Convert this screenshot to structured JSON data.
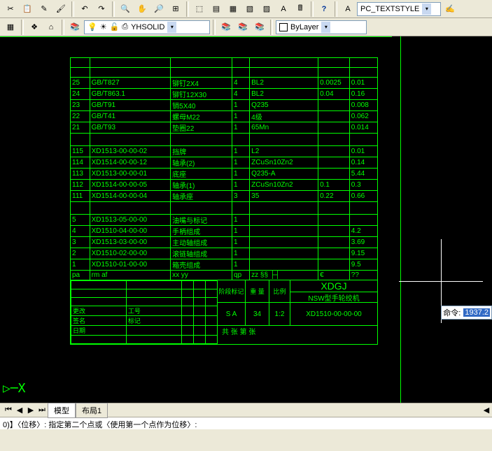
{
  "toolbar": {
    "textstyle_label": "PC_TEXTSTYLE",
    "layer_label": "YHSOLID",
    "bylayer_label": "ByLayer"
  },
  "bom_upper": [
    {
      "n": "25",
      "std": "GB/T827",
      "desc": "铆钉2X4",
      "q": "4",
      "mat": "BL2",
      "w1": "0.0025",
      "w2": "0.01"
    },
    {
      "n": "24",
      "std": "GB/T863.1",
      "desc": "铆钉12X30",
      "q": "4",
      "mat": "BL2",
      "w1": "0.04",
      "w2": "0.16"
    },
    {
      "n": "23",
      "std": "GB/T91",
      "desc": "销5X40",
      "q": "1",
      "mat": "Q235",
      "w1": "",
      "w2": "0.008"
    },
    {
      "n": "22",
      "std": "GB/T41",
      "desc": "螺母M22",
      "q": "1",
      "mat": "4级",
      "w1": "",
      "w2": "0.062"
    },
    {
      "n": "21",
      "std": "GB/T93",
      "desc": "垫圈22",
      "q": "1",
      "mat": "65Mn",
      "w1": "",
      "w2": "0.014"
    }
  ],
  "bom_mid": [
    {
      "n": "115",
      "std": "XD1513-00-00-02",
      "desc": "挡牌",
      "q": "1",
      "mat": "L2",
      "w1": "",
      "w2": "0.01"
    },
    {
      "n": "114",
      "std": "XD1514-00-00-12",
      "desc": "轴承(2)",
      "q": "1",
      "mat": "ZCuSn10Zn2",
      "w1": "",
      "w2": "0.14"
    },
    {
      "n": "113",
      "std": "XD1513-00-00-01",
      "desc": "底座",
      "q": "1",
      "mat": "Q235-A",
      "w1": "",
      "w2": "5.44"
    },
    {
      "n": "112",
      "std": "XD1514-00-00-05",
      "desc": "轴承(1)",
      "q": "1",
      "mat": "ZCuSn10Zn2",
      "w1": "0.1",
      "w2": "0.3"
    },
    {
      "n": "111",
      "std": "XD1514-00-00-04",
      "desc": "轴承座",
      "q": "3",
      "mat": "35",
      "w1": "0.22",
      "w2": "0.66"
    }
  ],
  "bom_lower": [
    {
      "n": "5",
      "std": "XD1513-05-00-00",
      "desc": "油嘴与标记",
      "q": "1",
      "mat": "",
      "w1": "",
      "w2": ""
    },
    {
      "n": "4",
      "std": "XD1510-04-00-00",
      "desc": "手柄组成",
      "q": "1",
      "mat": "",
      "w1": "",
      "w2": "4.2"
    },
    {
      "n": "3",
      "std": "XD1513-03-00-00",
      "desc": "主动轴组成",
      "q": "1",
      "mat": "",
      "w1": "",
      "w2": "3.69"
    },
    {
      "n": "2",
      "std": "XD1510-02-00-00",
      "desc": "滚链轴组成",
      "q": "1",
      "mat": "",
      "w1": "",
      "w2": "9.15"
    },
    {
      "n": "1",
      "std": "XD1510-01-00-00",
      "desc": "箱壳组成",
      "q": "1",
      "mat": "",
      "w1": "",
      "w2": "9.5"
    }
  ],
  "bom_header": {
    "c0": "pa",
    "c1": "rm         af",
    "c2": "xx       yy",
    "c3": "qp",
    "c4": "zz",
    "c5": "€",
    "c6": "??",
    "sym": "§§    ├┤"
  },
  "titleblock": {
    "company": "XDGJ",
    "product": "NSW型手轮绞机",
    "drawing_no": "XD1510-00-00-00",
    "mark": "S A",
    "qty": "34",
    "scale": "1:2",
    "lbl_mark": "阶段标记",
    "lbl_qty": "重  量",
    "lbl_scale": "比例",
    "footer": "共   张     第    张",
    "left_labels": [
      "更改",
      "签名",
      "日期",
      "工号",
      "标记"
    ]
  },
  "tabs": {
    "model": "模型",
    "layout1": "布局1"
  },
  "command": {
    "prompt": "命令:",
    "value": "1937.2"
  },
  "cmdline": "0)】〈位移〉:  指定第二个点或〈使用第一个点作为位移〉:",
  "ucs": "▷─X"
}
